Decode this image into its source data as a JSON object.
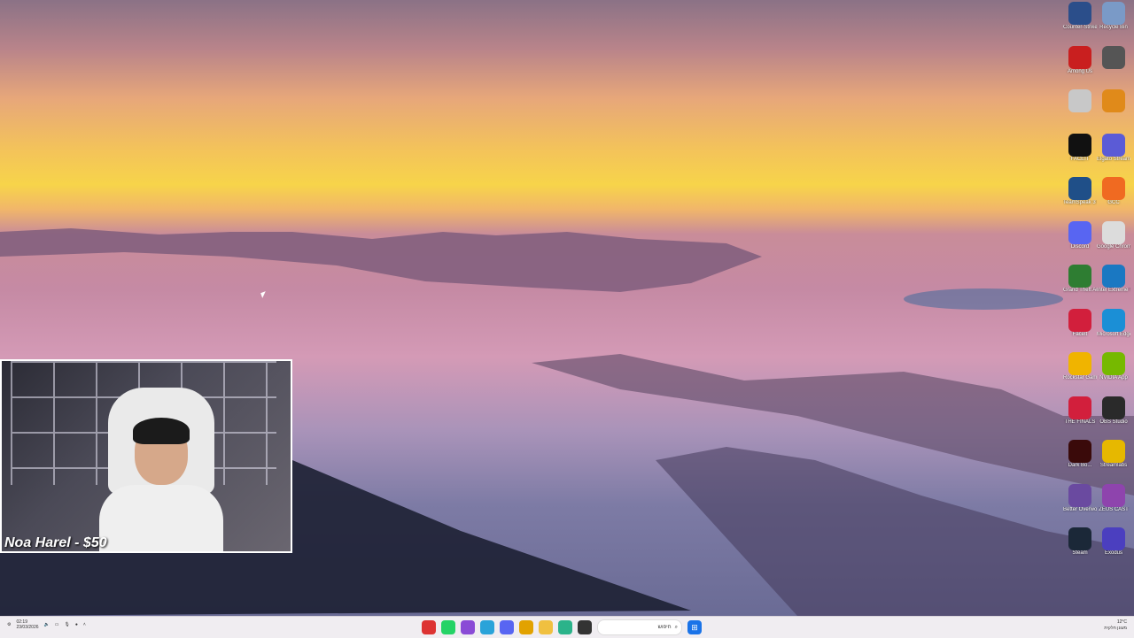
{
  "desktop_icons": [
    {
      "label": "Counter-Strike 2",
      "icon": "cs2-icon",
      "color": "#2b4e8a"
    },
    {
      "label": "Recycle Bin",
      "icon": "recycle-bin-icon",
      "color": "#7a9ac7"
    },
    {
      "label": "Among Us",
      "icon": "among-us-icon",
      "color": "#c91f1f"
    },
    {
      "label": "",
      "icon": "clock-icon",
      "color": "#555555"
    },
    {
      "label": "",
      "icon": "app-icon",
      "color": "#c8c8c8"
    },
    {
      "label": "",
      "icon": "headphones-icon",
      "color": "#e08a1a"
    },
    {
      "label": "FACEIT",
      "icon": "faceit-icon",
      "color": "#111111"
    },
    {
      "label": "Elgato Stream Deck",
      "icon": "stream-deck-icon",
      "color": "#5b5bd6"
    },
    {
      "label": "TeamSpeak 3 Client",
      "icon": "teamspeak-icon",
      "color": "#1f4f88"
    },
    {
      "label": "GCC",
      "icon": "gcc-icon",
      "color": "#f06a21"
    },
    {
      "label": "Discord",
      "icon": "discord-icon",
      "color": "#5865f2"
    },
    {
      "label": "Google Chrome",
      "icon": "chrome-icon",
      "color": "#dcdcdc"
    },
    {
      "label": "Grand Theft Auto V",
      "icon": "gta-icon",
      "color": "#2e7d32"
    },
    {
      "label": "Intel Extreme Tu...",
      "icon": "intel-icon",
      "color": "#1a78c2"
    },
    {
      "label": "FaceIt",
      "icon": "faceit-a-icon",
      "color": "#d21f3c"
    },
    {
      "label": "Microsoft Edge",
      "icon": "edge-icon",
      "color": "#1b8fd6"
    },
    {
      "label": "Rockstar Games",
      "icon": "rockstar-icon",
      "color": "#f0b400"
    },
    {
      "label": "NVIDIA App",
      "icon": "nvidia-icon",
      "color": "#76b900"
    },
    {
      "label": "THE FINALS",
      "icon": "the-finals-icon",
      "color": "#d21f3c"
    },
    {
      "label": "OBS Studio",
      "icon": "obs-icon",
      "color": "#2a2a2a"
    },
    {
      "label": "Dark Bo...",
      "icon": "dark-app-icon",
      "color": "#3a0a0a"
    },
    {
      "label": "Streamlabs",
      "icon": "streamlabs-icon",
      "color": "#e6b800"
    },
    {
      "label": "Better Overwolf",
      "icon": "overwolf-icon",
      "color": "#6a4aa0"
    },
    {
      "label": "ZEUS CAST",
      "icon": "zeus-cast-icon",
      "color": "#8e44ad"
    },
    {
      "label": "Steam",
      "icon": "steam-icon",
      "color": "#1b2838"
    },
    {
      "label": "Exodus",
      "icon": "exodus-icon",
      "color": "#4b3fbf"
    }
  ],
  "webcam": {
    "donation_text": "Noa Harel - $50"
  },
  "taskbar": {
    "tray_left_time": "02:19",
    "tray_left_date": "23/03/2026",
    "tray_icons": [
      "settings-icon",
      "volume-icon",
      "network-icon",
      "mic-icon",
      "bluetooth-icon",
      "chevron-up-icon"
    ],
    "apps": [
      {
        "icon": "red-app-icon",
        "color": "#d33"
      },
      {
        "icon": "whatsapp-icon",
        "color": "#25d366"
      },
      {
        "icon": "messenger-icon",
        "color": "#8a4bd6"
      },
      {
        "icon": "telegram-icon",
        "color": "#2aa3d9"
      },
      {
        "icon": "discord-icon",
        "color": "#5865f2"
      },
      {
        "icon": "chrome-icon",
        "color": "#e2a200"
      },
      {
        "icon": "file-explorer-icon",
        "color": "#f0c040"
      },
      {
        "icon": "paint-icon",
        "color": "#2bb38a"
      },
      {
        "icon": "terminal-icon",
        "color": "#333333"
      }
    ],
    "search_placeholder": "חיפוש",
    "weather": "12°C",
    "weather_sub": "מעונן חלקית"
  }
}
